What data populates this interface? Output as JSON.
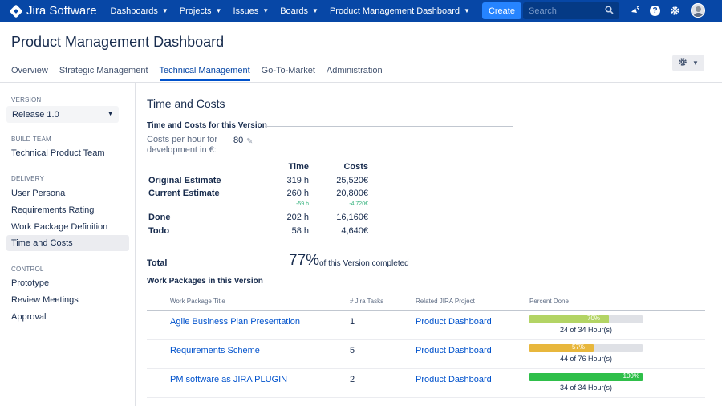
{
  "nav": {
    "brand": "Jira Software",
    "items": [
      "Dashboards",
      "Projects",
      "Issues",
      "Boards",
      "Product Management Dashboard"
    ],
    "create_label": "Create",
    "search_placeholder": "Search"
  },
  "page": {
    "title": "Product Management Dashboard",
    "tabs": [
      "Overview",
      "Strategic Management",
      "Technical Management",
      "Go-To-Market",
      "Administration"
    ],
    "active_tab": "Technical Management"
  },
  "sidebar": {
    "version_label": "VERSION",
    "version_value": "Release 1.0",
    "build_team_label": "BUILD TEAM",
    "build_team_items": [
      "Technical Product Team"
    ],
    "delivery_label": "DELIVERY",
    "delivery_items": [
      "User Persona",
      "Requirements Rating",
      "Work Package Definition",
      "Time and Costs"
    ],
    "control_label": "CONTROL",
    "control_items": [
      "Prototype",
      "Review Meetings",
      "Approval"
    ],
    "active_item": "Time and Costs"
  },
  "main": {
    "title": "Time and Costs",
    "section_title": "Time and Costs for this Version",
    "cost_label": "Costs per hour for development in €:",
    "cost_value": "80",
    "col_time": "Time",
    "col_costs": "Costs",
    "rows": [
      {
        "label": "Original Estimate",
        "time": "319 h",
        "costs": "25,520€"
      },
      {
        "label": "Current Estimate",
        "time": "260 h",
        "costs": "20,800€",
        "time_delta": "-59 h",
        "costs_delta": "-4,720€"
      },
      {
        "label": "Done",
        "time": "202 h",
        "costs": "16,160€"
      },
      {
        "label": "Todo",
        "time": "58 h",
        "costs": "4,640€"
      }
    ],
    "total_label": "Total",
    "total_percent": "77%",
    "total_text": "of this Version completed",
    "wp_title": "Work Packages in this Version",
    "wp_columns": [
      "Work Package Title",
      "# Jira Tasks",
      "Related JIRA Project",
      "Percent Done"
    ],
    "work_packages": [
      {
        "title": "Agile Business Plan Presentation",
        "tasks": "1",
        "project": "Product Dashboard",
        "percent_label": "70%",
        "percent": 0.7,
        "hours": "24 of 34 Hour(s)",
        "color": "#b3d465"
      },
      {
        "title": "Requirements Scheme",
        "tasks": "5",
        "project": "Product Dashboard",
        "percent_label": "57%",
        "percent": 0.57,
        "hours": "44 of 76 Hour(s)",
        "color": "#e8b73c"
      },
      {
        "title": "PM software as JIRA PLUGIN",
        "tasks": "2",
        "project": "Product Dashboard",
        "percent_label": "100%",
        "percent": 1.0,
        "hours": "34 of 34 Hour(s)",
        "color": "#2fbf4a"
      }
    ]
  },
  "colors": {
    "nav_bg": "#0747a6",
    "accent": "#0052cc",
    "create_button": "#2684ff"
  }
}
